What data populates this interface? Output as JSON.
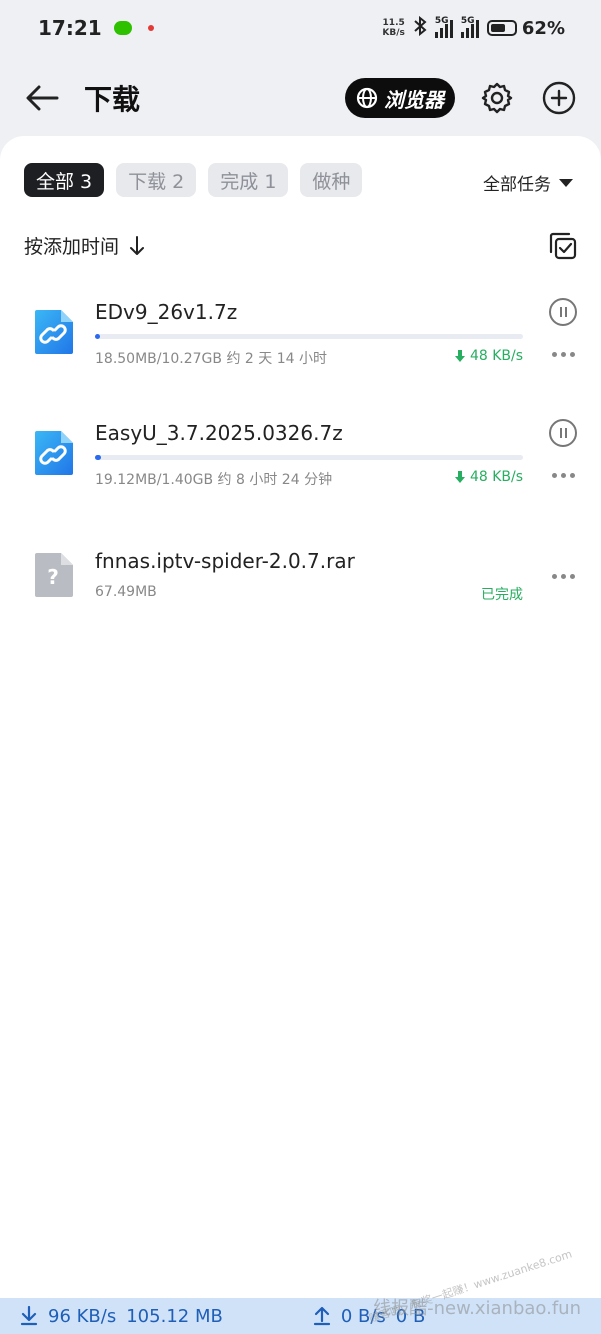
{
  "status_bar": {
    "time": "17:21",
    "net_speed_value": "11.5",
    "net_speed_unit": "KB/s",
    "signal1_tag": "5G",
    "signal2_tag": "5G",
    "battery": "62%",
    "battery_level": 0.62
  },
  "header": {
    "title": "下载",
    "browser_label": "浏览器"
  },
  "tabs": [
    {
      "label": "全部 3",
      "active": true
    },
    {
      "label": "下载 2",
      "active": false
    },
    {
      "label": "完成 1",
      "active": false
    },
    {
      "label": "做种",
      "active": false
    }
  ],
  "filter_label": "全部任务",
  "sort_label": "按添加时间",
  "downloads": [
    {
      "name": "EDv9_26v1.7z",
      "meta": "18.50MB/10.27GB 约 2 天 14 小时",
      "speed": "48 KB/s",
      "progress": 0.0018,
      "status": "downloading",
      "icon": "link-icon"
    },
    {
      "name": "EasyU_3.7.2025.0326.7z",
      "meta": "19.12MB/1.40GB 约 8 小时 24 分钟",
      "speed": "48 KB/s",
      "progress": 0.013,
      "status": "downloading",
      "icon": "link-icon"
    },
    {
      "name": "fnnas.iptv-spider-2.0.7.rar",
      "meta": "67.49MB",
      "status_text": "已完成",
      "status": "completed",
      "icon": "unknown-file-icon"
    }
  ],
  "bottom_bar": {
    "download_speed": "96 KB/s",
    "download_total": "105.12 MB",
    "upload_speed": "0 B/s",
    "upload_total": "0 B"
  },
  "watermark": {
    "text": "线报酷-new.xianbao.fun",
    "text2": "赚客吧，有奖一起赚！www.zuanke8.com"
  },
  "colors": {
    "accent": "#2a6af0",
    "success": "#27ae60",
    "bottom_bar_bg": "#cfe2f8"
  }
}
